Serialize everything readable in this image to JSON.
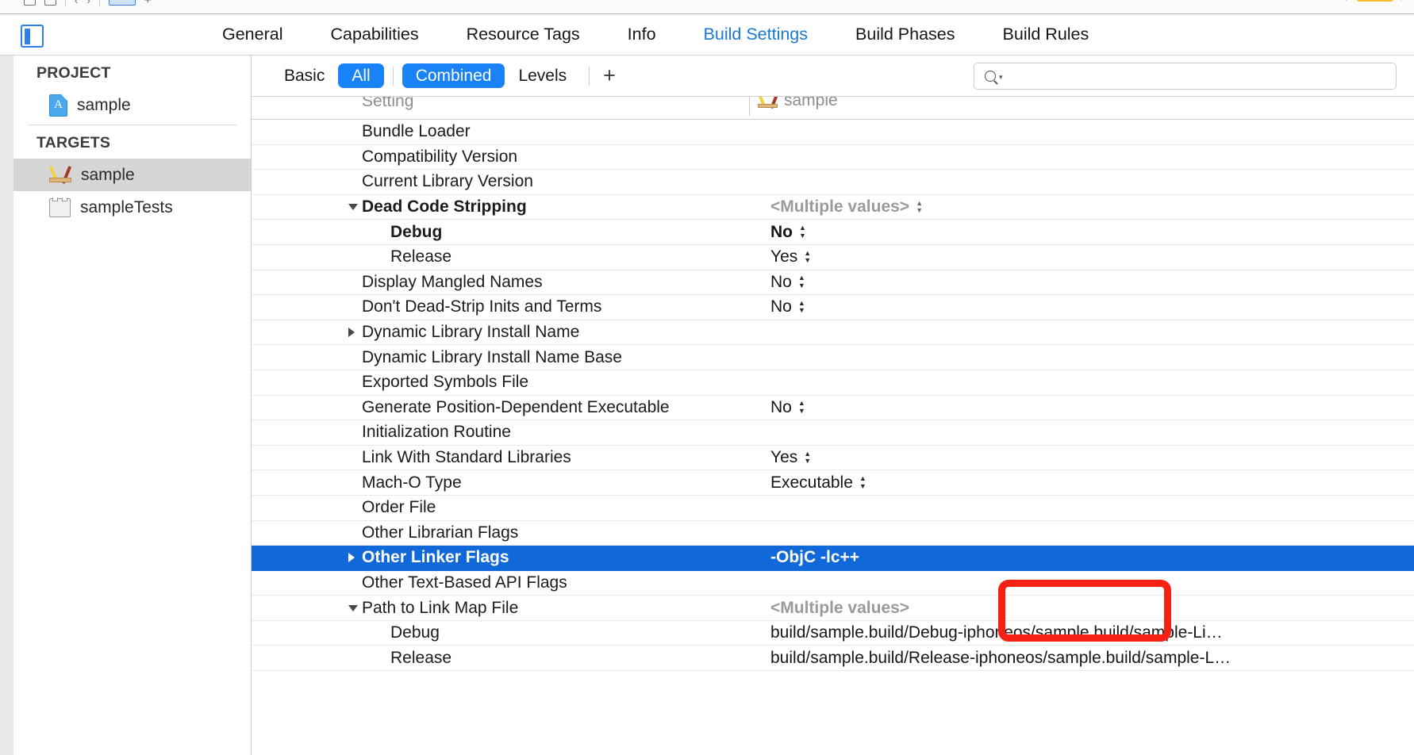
{
  "toolbar": {
    "left_icons": [
      "panels-icon",
      "chevron-left-icon",
      "chevron-right-icon",
      "editor-icon",
      "plus-icon"
    ],
    "right_icons": [
      "triangle-icon",
      "yellow-status-bar",
      "triangle-icon-2"
    ]
  },
  "tabbar": {
    "nav_toggle_icon": "show-navigator-icon",
    "tabs": [
      {
        "label": "General",
        "active": false
      },
      {
        "label": "Capabilities",
        "active": false
      },
      {
        "label": "Resource Tags",
        "active": false
      },
      {
        "label": "Info",
        "active": false
      },
      {
        "label": "Build Settings",
        "active": true
      },
      {
        "label": "Build Phases",
        "active": false
      },
      {
        "label": "Build Rules",
        "active": false
      }
    ]
  },
  "sidebar": {
    "project_header": "PROJECT",
    "project_items": [
      {
        "label": "sample",
        "icon": "xcode-project-icon",
        "selected": false
      }
    ],
    "targets_header": "TARGETS",
    "target_items": [
      {
        "label": "sample",
        "icon": "target-icon",
        "selected": true
      },
      {
        "label": "sampleTests",
        "icon": "test-bundle-icon",
        "selected": false
      }
    ]
  },
  "filterbar": {
    "segments": [
      {
        "label": "Basic",
        "on": false
      },
      {
        "label": "All",
        "on": true
      },
      {
        "label": "Combined",
        "on": true
      },
      {
        "label": "Levels",
        "on": false
      }
    ],
    "add_label": "+",
    "search_icon": "search-icon",
    "search_value": "",
    "search_placeholder": ""
  },
  "table": {
    "column_setting": "Setting",
    "column_target": "sample",
    "column_target_icon": "target-icon",
    "rows": [
      {
        "name": "Bundle Loader",
        "value": "",
        "disclosure": "none",
        "indent": false,
        "bold": false,
        "selected": false,
        "stepper": false,
        "muted": false
      },
      {
        "name": "Compatibility Version",
        "value": "",
        "disclosure": "none",
        "indent": false,
        "bold": false,
        "selected": false,
        "stepper": false,
        "muted": false
      },
      {
        "name": "Current Library Version",
        "value": "",
        "disclosure": "none",
        "indent": false,
        "bold": false,
        "selected": false,
        "stepper": false,
        "muted": false
      },
      {
        "name": "Dead Code Stripping",
        "value": "<Multiple values>",
        "disclosure": "open",
        "indent": false,
        "bold": true,
        "selected": false,
        "stepper": true,
        "muted": true
      },
      {
        "name": "Debug",
        "value": "No",
        "disclosure": "none",
        "indent": true,
        "bold": true,
        "selected": false,
        "stepper": true,
        "muted": false
      },
      {
        "name": "Release",
        "value": "Yes",
        "disclosure": "none",
        "indent": true,
        "bold": false,
        "selected": false,
        "stepper": true,
        "muted": false
      },
      {
        "name": "Display Mangled Names",
        "value": "No",
        "disclosure": "none",
        "indent": false,
        "bold": false,
        "selected": false,
        "stepper": true,
        "muted": false
      },
      {
        "name": "Don't Dead-Strip Inits and Terms",
        "value": "No",
        "disclosure": "none",
        "indent": false,
        "bold": false,
        "selected": false,
        "stepper": true,
        "muted": false
      },
      {
        "name": "Dynamic Library Install Name",
        "value": "",
        "disclosure": "closed",
        "indent": false,
        "bold": false,
        "selected": false,
        "stepper": false,
        "muted": false
      },
      {
        "name": "Dynamic Library Install Name Base",
        "value": "",
        "disclosure": "none",
        "indent": false,
        "bold": false,
        "selected": false,
        "stepper": false,
        "muted": false
      },
      {
        "name": "Exported Symbols File",
        "value": "",
        "disclosure": "none",
        "indent": false,
        "bold": false,
        "selected": false,
        "stepper": false,
        "muted": false
      },
      {
        "name": "Generate Position-Dependent Executable",
        "value": "No",
        "disclosure": "none",
        "indent": false,
        "bold": false,
        "selected": false,
        "stepper": true,
        "muted": false
      },
      {
        "name": "Initialization Routine",
        "value": "",
        "disclosure": "none",
        "indent": false,
        "bold": false,
        "selected": false,
        "stepper": false,
        "muted": false
      },
      {
        "name": "Link With Standard Libraries",
        "value": "Yes",
        "disclosure": "none",
        "indent": false,
        "bold": false,
        "selected": false,
        "stepper": true,
        "muted": false
      },
      {
        "name": "Mach-O Type",
        "value": "Executable",
        "disclosure": "none",
        "indent": false,
        "bold": false,
        "selected": false,
        "stepper": true,
        "muted": false
      },
      {
        "name": "Order File",
        "value": "",
        "disclosure": "none",
        "indent": false,
        "bold": false,
        "selected": false,
        "stepper": false,
        "muted": false
      },
      {
        "name": "Other Librarian Flags",
        "value": "",
        "disclosure": "none",
        "indent": false,
        "bold": false,
        "selected": false,
        "stepper": false,
        "muted": false
      },
      {
        "name": "Other Linker Flags",
        "value": "-ObjC -lc++",
        "disclosure": "closed",
        "indent": false,
        "bold": true,
        "selected": true,
        "stepper": false,
        "muted": false
      },
      {
        "name": "Other Text-Based API Flags",
        "value": "",
        "disclosure": "none",
        "indent": false,
        "bold": false,
        "selected": false,
        "stepper": false,
        "muted": false
      },
      {
        "name": "Path to Link Map File",
        "value": "<Multiple values>",
        "disclosure": "open",
        "indent": false,
        "bold": false,
        "selected": false,
        "stepper": false,
        "muted": true
      },
      {
        "name": "Debug",
        "value": "build/sample.build/Debug-iphoneos/sample.build/sample-Li…",
        "disclosure": "none",
        "indent": true,
        "bold": false,
        "selected": false,
        "stepper": false,
        "muted": false
      },
      {
        "name": "Release",
        "value": "build/sample.build/Release-iphoneos/sample.build/sample-L…",
        "disclosure": "none",
        "indent": true,
        "bold": false,
        "selected": false,
        "stepper": false,
        "muted": false
      }
    ]
  },
  "annotation": {
    "name": "highlight-box",
    "color": "#f52214",
    "targets_row": "Other Linker Flags"
  },
  "colors": {
    "accent_blue": "#1a82f7",
    "selection_blue": "#1169d9",
    "tab_active": "#1878d4",
    "annotation_red": "#f52214"
  }
}
